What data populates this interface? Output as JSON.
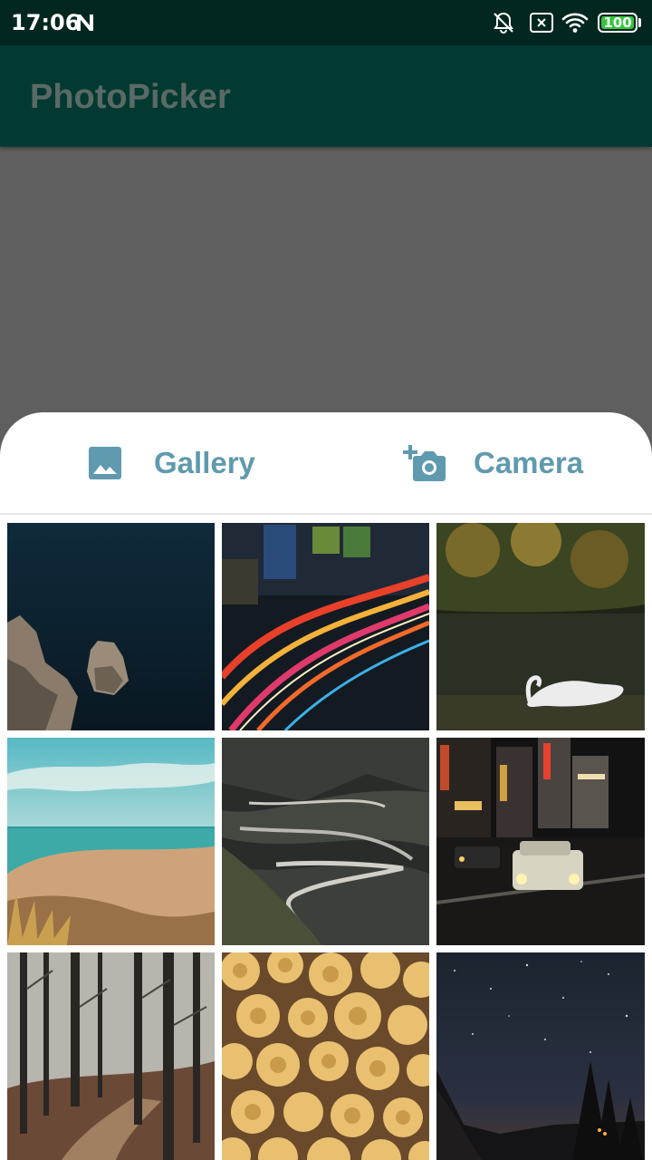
{
  "status_bar": {
    "time": "17:06",
    "battery_level": "100",
    "battery_fraction": 1.0,
    "icons": [
      "n-icon",
      "bell-muted-icon",
      "sim-none-icon",
      "wifi-icon",
      "battery-icon"
    ]
  },
  "app_bar": {
    "title": "PhotoPicker",
    "background_color": "#023a31"
  },
  "sheet": {
    "gallery": {
      "label": "Gallery",
      "icon": "image-icon"
    },
    "camera": {
      "label": "Camera",
      "icon": "add-a-photo-icon"
    },
    "accent_color": "#5f9aae",
    "photos": [
      {
        "id": "photo-sea-rocks"
      },
      {
        "id": "photo-light-trails"
      },
      {
        "id": "photo-swan-lake"
      },
      {
        "id": "photo-beach"
      },
      {
        "id": "photo-mountain-road"
      },
      {
        "id": "photo-night-street"
      },
      {
        "id": "photo-foggy-forest"
      },
      {
        "id": "photo-flowers"
      },
      {
        "id": "photo-night-sky"
      }
    ]
  }
}
